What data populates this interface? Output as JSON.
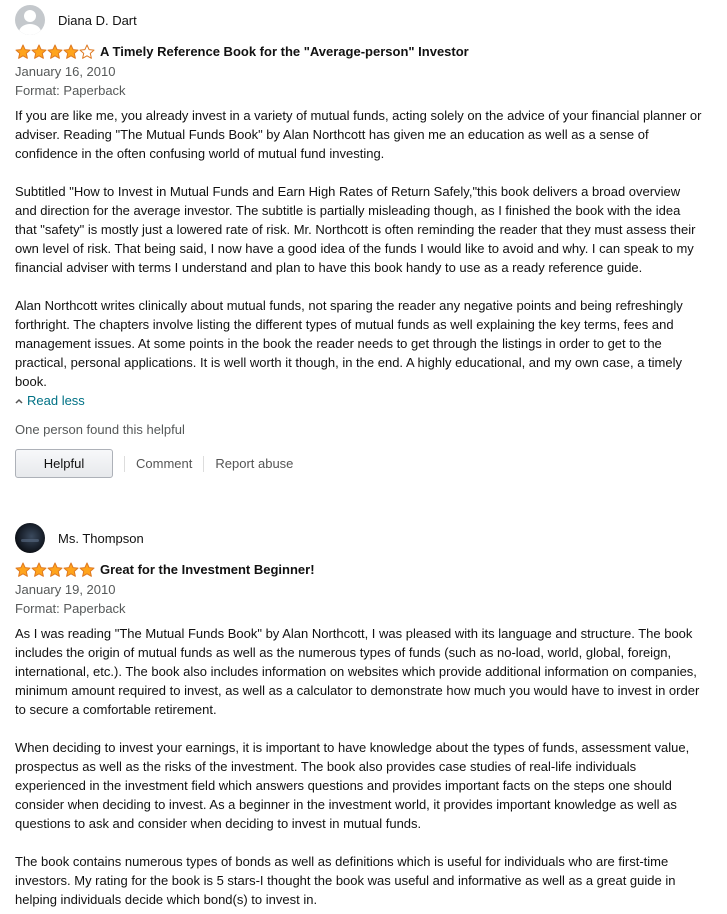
{
  "reviews": [
    {
      "author": "Diana D. Dart",
      "rating": 4,
      "rating_max": 5,
      "title": "A Timely Reference Book for the \"Average-person\" Investor",
      "date": "January 16, 2010",
      "format": "Format: Paperback",
      "paragraphs": [
        "If you are like me, you already invest in a variety of mutual funds, acting solely on the advice of your financial planner or adviser. Reading \"The Mutual Funds Book\" by Alan Northcott has given me an education as well as a sense of confidence in the often confusing world of mutual fund investing.",
        "Subtitled \"How to Invest in Mutual Funds and Earn High Rates of Return Safely,\"this book delivers a broad overview and direction for the average investor. The subtitle is partially misleading though, as I finished the book with the idea that \"safety\" is mostly just a lowered rate of risk. Mr. Northcott is often reminding the reader that they must assess their own level of risk. That being said, I now have a good idea of the funds I would like to avoid and why. I can speak to my financial adviser with terms I understand and plan to have this book handy to use as a ready reference guide.",
        "Alan Northcott writes clinically about mutual funds, not sparing the reader any negative points and being refreshingly forthright. The chapters involve listing the different types of mutual funds as well explaining the key terms, fees and management issues. At some points in the book the reader needs to get through the listings in order to get to the practical, personal applications. It is well worth it though, in the end. A highly educational, and my own case, a timely book."
      ],
      "read_less_label": "Read less",
      "helpful_count_text": "One person found this helpful",
      "helpful_button_label": "Helpful",
      "comment_label": "Comment",
      "report_label": "Report abuse"
    },
    {
      "author": "Ms. Thompson",
      "rating": 5,
      "rating_max": 5,
      "title": "Great for the Investment Beginner!",
      "date": "January 19, 2010",
      "format": "Format: Paperback",
      "paragraphs": [
        "As I was reading \"The Mutual Funds Book\" by Alan Northcott, I was pleased with its language and structure. The book includes the origin of mutual funds as well as the numerous types of funds (such as no-load, world, global, foreign, international, etc.). The book also includes information on websites which provide additional information on companies, minimum amount required to invest, as well as a calculator to demonstrate how much you would have to invest in order to secure a comfortable retirement.",
        "When deciding to invest your earnings, it is important to have knowledge about the types of funds, assessment value, prospectus as well as the risks of the investment. The book also provides case studies of real-life individuals experienced in the investment field which answers questions and provides important facts on the steps one should consider when deciding to invest. As a beginner in the investment world, it provides important knowledge as well as questions to ask and consider when deciding to invest in mutual funds.",
        "The book contains numerous types of bonds as well as definitions which is useful for individuals who are first-time investors. My rating for the book is 5 stars-I thought the book was useful and informative as well as a great guide in helping individuals decide which bond(s) to invest in."
      ]
    }
  ],
  "colors": {
    "star_fill": "#ffa41c",
    "star_stroke": "#de7921",
    "star_empty": "#ffffff",
    "link": "#007185",
    "meta_text": "#565959"
  },
  "icons": {
    "avatar_1": "default-avatar-icon",
    "avatar_2": "profile-photo",
    "star": "star-icon",
    "read_less": "chevron-up-icon"
  }
}
